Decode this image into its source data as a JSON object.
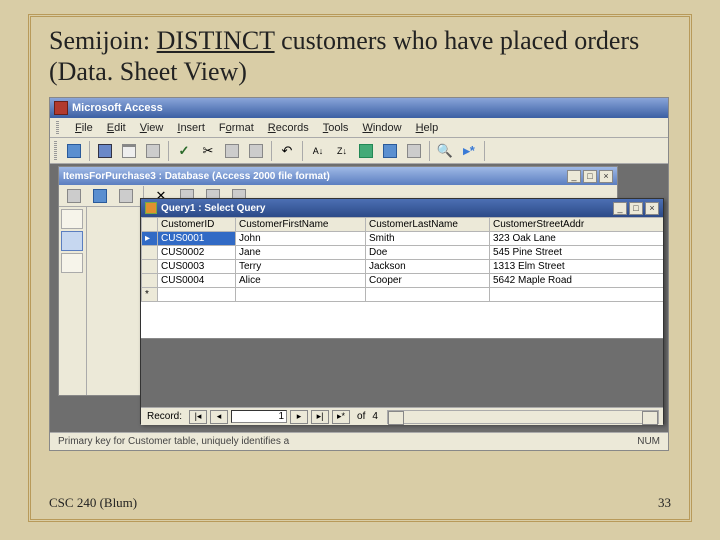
{
  "slide": {
    "title_pre": "Semijoin: ",
    "title_underlined": "DISTINCT",
    "title_post": " customers who have placed orders (Data. Sheet View)",
    "footer_left": "CSC 240 (Blum)",
    "footer_right": "33"
  },
  "access": {
    "app_title": "Microsoft Access",
    "menus": [
      "File",
      "Edit",
      "View",
      "Insert",
      "Format",
      "Records",
      "Tools",
      "Window",
      "Help"
    ],
    "db_title": "ItemsForPurchase3 : Database (Access 2000 file format)",
    "query_title": "Query1 : Select Query",
    "columns": [
      "CustomerID",
      "CustomerFirstName",
      "CustomerLastName",
      "CustomerStreetAddr"
    ],
    "rows": [
      {
        "id": "CUS0001",
        "first": "John",
        "last": "Smith",
        "addr": "323 Oak Lane"
      },
      {
        "id": "CUS0002",
        "first": "Jane",
        "last": "Doe",
        "addr": "545 Pine Street"
      },
      {
        "id": "CUS0003",
        "first": "Terry",
        "last": "Jackson",
        "addr": "1313 Elm Street"
      },
      {
        "id": "CUS0004",
        "first": "Alice",
        "last": "Cooper",
        "addr": "5642 Maple Road"
      }
    ],
    "recnav": {
      "label": "Record:",
      "current": "1",
      "of_label": "of",
      "total": "4"
    },
    "status_left": "Primary key for Customer table, uniquely identifies a",
    "status_right": "NUM"
  }
}
